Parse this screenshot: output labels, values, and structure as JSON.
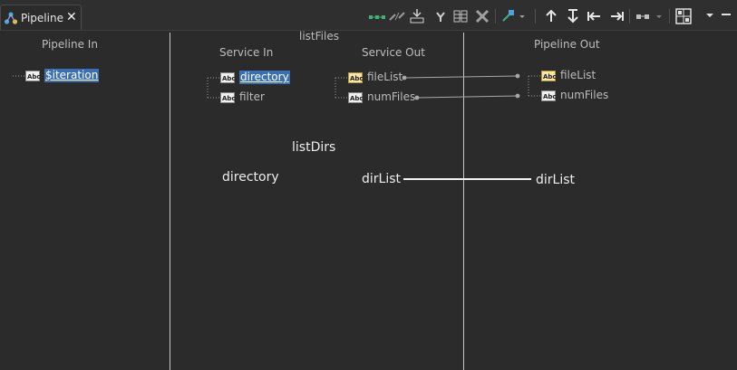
{
  "tab": {
    "title": "Pipeline",
    "close_glyph": "✕"
  },
  "toolbar": {
    "buttons": [
      "map-icon",
      "disconnect-icon",
      "drop-icon",
      "transform-icon",
      "columns-icon",
      "delete-icon",
      "link-dropdown-icon",
      "move-up-icon",
      "move-down-icon",
      "shift-left-icon",
      "shift-right-icon",
      "view-dropdown-icon",
      "layout-icon",
      "view-menu-icon",
      "minimize-icon"
    ]
  },
  "pipeline_in": {
    "header": "Pipeline In",
    "items": [
      {
        "label": "$iteration",
        "type": "string",
        "selected": true
      }
    ]
  },
  "service": {
    "title": "listFiles",
    "service_in": {
      "header": "Service In",
      "items": [
        {
          "label": "directory",
          "type": "string",
          "selected": true
        },
        {
          "label": "filter",
          "type": "string",
          "selected": false
        }
      ]
    },
    "service_out": {
      "header": "Service Out",
      "items": [
        {
          "label": "fileList",
          "type": "string-list"
        },
        {
          "label": "numFiles",
          "type": "string"
        }
      ]
    }
  },
  "pipeline_out": {
    "header": "Pipeline Out",
    "items": [
      {
        "label": "fileList",
        "type": "string-list"
      },
      {
        "label": "numFiles",
        "type": "string"
      }
    ]
  },
  "mapping_labels": {
    "service_name": "listDirs",
    "input": "directory",
    "output": "dirList",
    "target": "dirList"
  },
  "colors": {
    "background": "#2b2b2b",
    "selection": "#3a6fb3",
    "divider": "#c8c8c8",
    "toolbar_green": "#3cb371"
  }
}
